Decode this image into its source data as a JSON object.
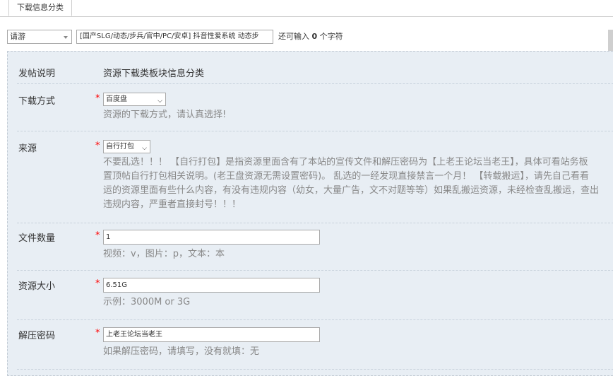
{
  "tabs": {
    "active": "下载信息分类"
  },
  "subject": {
    "type_value": "请游",
    "title_value": "[国产SLG/动态/步兵/官中/PC/安卓] 抖音性爱系统 动态步",
    "counter_prefix": "还可输入",
    "counter_number": "0",
    "counter_suffix": "个字符"
  },
  "form": {
    "note": {
      "label": "发帖说明",
      "value": "资源下载类板块信息分类"
    },
    "method": {
      "label": "下载方式",
      "required": "*",
      "selected": "百度盘",
      "hint": "资源的下载方式，请认真选择!"
    },
    "source": {
      "label": "来源",
      "required": "*",
      "selected": "自行打包",
      "hint_lines": [
        "不要乱选！！！ 【自行打包】是指资源里面含有了本站的宣传文件和解压密码为【上老王论坛当老王】，具体可看站务板",
        "置顶帖自行打包相关说明。(老王盘资源无需设置密码)。 乱选的一经发现直接禁言一个月！ 【转载搬运】，请先自己看看",
        "运的资源里面有些什么内容，有没有违规内容（幼女，大量广告，文不对题等等）如果乱搬运资源，未经检查乱搬运，查出",
        "违规内容，严重者直接封号！！！"
      ]
    },
    "file_count": {
      "label": "文件数量",
      "required": "*",
      "value": "1",
      "hint": "视频：v，图片：p，文本：本"
    },
    "size": {
      "label": "资源大小",
      "required": "*",
      "value": "6.51G",
      "hint": "示例：3000M or 3G"
    },
    "password": {
      "label": "解压密码",
      "required": "*",
      "value": "上老王论坛当老王",
      "hint": "如果解压密码，请填写，没有就填：无"
    }
  }
}
